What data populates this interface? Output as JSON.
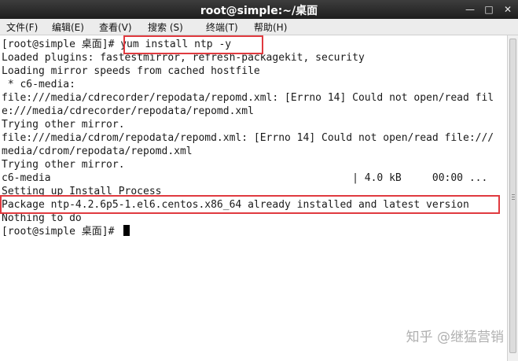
{
  "window": {
    "title": "root@simple:~/桌面",
    "minimize_glyph": "—",
    "maximize_glyph": "□",
    "close_glyph": "✕"
  },
  "menu": {
    "items": [
      "文件(F)",
      "编辑(E)",
      "查看(V)",
      "搜索 (S)",
      "终端(T)",
      "帮助(H)"
    ]
  },
  "terminal": {
    "lines": [
      "[root@simple 桌面]# yum install ntp -y",
      "Loaded plugins: fastestmirror, refresh-packagekit, security",
      "Loading mirror speeds from cached hostfile",
      " * c6-media:",
      "file:///media/cdrecorder/repodata/repomd.xml: [Errno 14] Could not open/read fil",
      "e:///media/cdrecorder/repodata/repomd.xml",
      "Trying other mirror.",
      "file:///media/cdrom/repodata/repomd.xml: [Errno 14] Could not open/read file:///",
      "media/cdrom/repodata/repomd.xml",
      "Trying other mirror.",
      "c6-media                                                 | 4.0 kB     00:00 ...",
      "Setting up Install Process",
      "Package ntp-4.2.6p5-1.el6.centos.x86_64 already installed and latest version",
      "Nothing to do",
      "[root@simple 桌面]# "
    ]
  },
  "watermark": "知乎 @继猛营销",
  "colors": {
    "highlight": "#e03a3f",
    "titlebar": "#2b2b2b"
  }
}
